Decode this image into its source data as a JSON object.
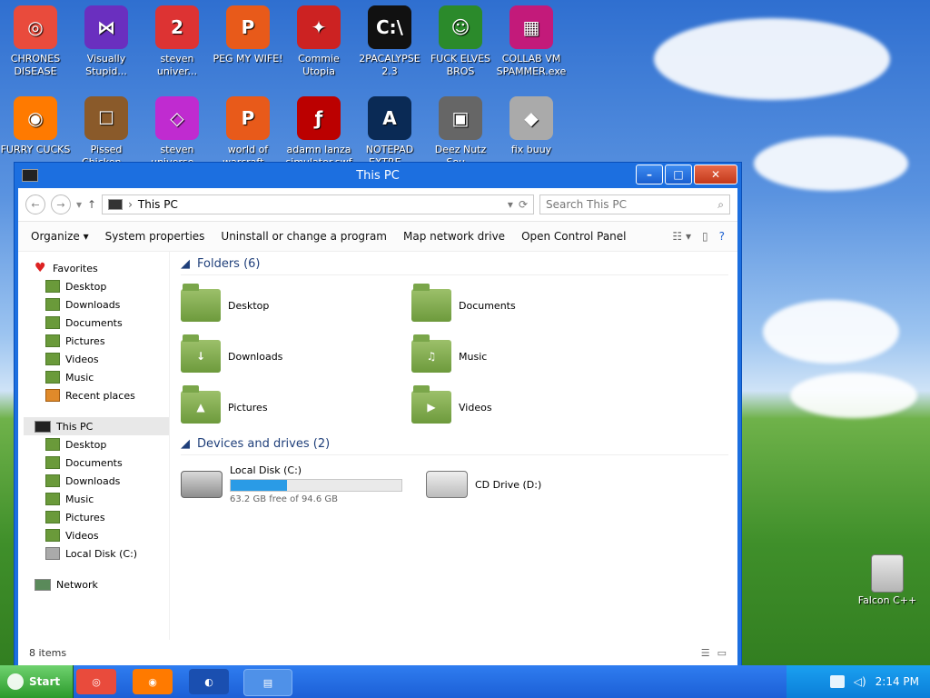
{
  "desktop_icons_row1": [
    {
      "label": "CHRONES DISEASE",
      "color": "#e94b3c",
      "glyph": "◎"
    },
    {
      "label": "Visually Stupid...",
      "color": "#6a2fbf",
      "glyph": "⋈"
    },
    {
      "label": "steven univer...",
      "color": "#d33",
      "glyph": "2"
    },
    {
      "label": "PEG MY WIFE!",
      "color": "#e85a1a",
      "glyph": "P"
    },
    {
      "label": "Commie Utopia",
      "color": "#c22",
      "glyph": "✦"
    },
    {
      "label": "2PACALYPSE 2.3",
      "color": "#111",
      "glyph": "C:\\"
    },
    {
      "label": "FUCK ELVES BROS",
      "color": "#2b8a2b",
      "glyph": "☺"
    },
    {
      "label": "COLLAB VM SPAMMER.exe",
      "color": "#c31a7a",
      "glyph": "▦"
    }
  ],
  "desktop_icons_row2": [
    {
      "label": "FURRY CUCKS",
      "color": "#ff7a00",
      "glyph": "◉"
    },
    {
      "label": "Pissed Chicken...",
      "color": "#8a5a2a",
      "glyph": "☐"
    },
    {
      "label": "steven universe...",
      "color": "#c02bd0",
      "glyph": "◇"
    },
    {
      "label": "world of warcraft...",
      "color": "#e85a1a",
      "glyph": "P"
    },
    {
      "label": "adamn lanza simulator.swf",
      "color": "#b00",
      "glyph": "ƒ"
    },
    {
      "label": "NOTEPAD EXTRE...",
      "color": "#0a2a55",
      "glyph": "A"
    },
    {
      "label": "Deez Nutz Sou...",
      "color": "#666",
      "glyph": "▣"
    },
    {
      "label": "fix buuy",
      "color": "#aaa",
      "glyph": "◆"
    }
  ],
  "window": {
    "title": "This PC",
    "address": "This PC",
    "search_placeholder": "Search This PC",
    "commands": [
      "Organize",
      "System properties",
      "Uninstall or change a program",
      "Map network drive",
      "Open Control Panel"
    ],
    "nav_favorites_head": "Favorites",
    "nav_favorites": [
      "Desktop",
      "Downloads",
      "Documents",
      "Pictures",
      "Videos",
      "Music",
      "Recent places"
    ],
    "nav_thispc_head": "This PC",
    "nav_thispc": [
      "Desktop",
      "Documents",
      "Downloads",
      "Music",
      "Pictures",
      "Videos",
      "Local Disk (C:)"
    ],
    "nav_network": "Network",
    "folders_header": "Folders (6)",
    "folders": [
      "Desktop",
      "Documents",
      "Downloads",
      "Music",
      "Pictures",
      "Videos"
    ],
    "devices_header": "Devices and drives (2)",
    "drive_c": {
      "name": "Local Disk (C:)",
      "detail": "63.2 GB free of 94.6 GB",
      "used_fraction": 0.332
    },
    "drive_d": {
      "name": "CD Drive (D:)"
    },
    "status": "8 items"
  },
  "recycle_label": "Falcon C++",
  "taskbar": {
    "start_label": "Start",
    "time": "2:14 PM"
  }
}
